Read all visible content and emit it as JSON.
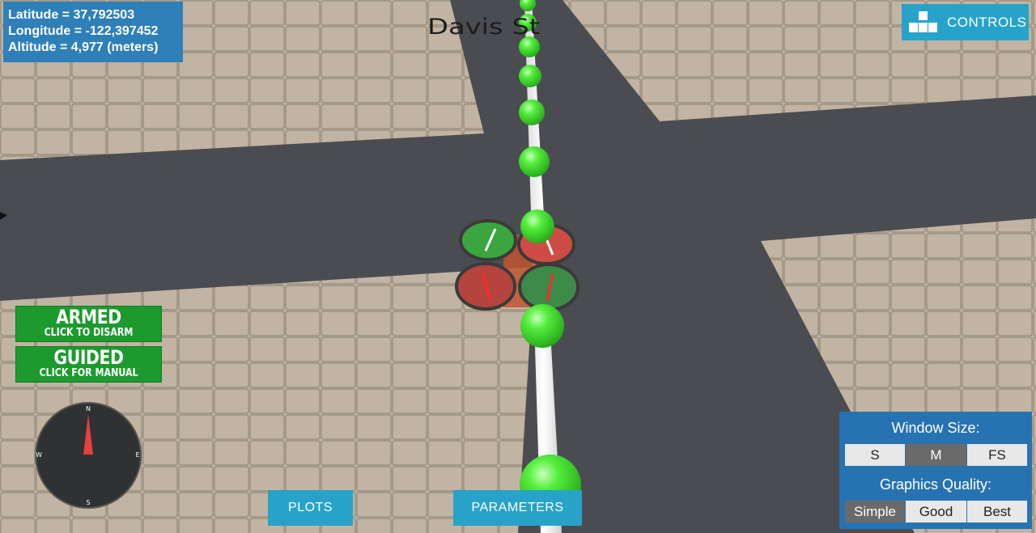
{
  "hud": {
    "latitude": "Latitude = 37,792503",
    "longitude": "Longitude = -122,397452",
    "altitude": "Altitude = 4,977 (meters)"
  },
  "scene": {
    "street_label": "Davis St"
  },
  "controls_button": {
    "label": "CONTROLS",
    "icon": "controls-icon"
  },
  "armed_button": {
    "title": "ARMED",
    "subtitle": "CLICK TO DISARM"
  },
  "guided_button": {
    "title": "GUIDED",
    "subtitle": "CLICK FOR MANUAL"
  },
  "compass": {
    "n": "N",
    "e": "E",
    "s": "S",
    "w": "W"
  },
  "bottom_buttons": {
    "plots": "PLOTS",
    "parameters": "PARAMETERS"
  },
  "settings_panel": {
    "window_size_title": "Window Size:",
    "window_sizes": [
      "S",
      "M",
      "FS"
    ],
    "window_size_selected": "M",
    "graphics_title": "Graphics Quality:",
    "graphics_options": [
      "Simple",
      "Good",
      "Best"
    ],
    "graphics_selected": "Simple"
  },
  "colors": {
    "panel_blue": "#2773b2",
    "button_cyan": "#27a3c9",
    "armed_green": "#1c9a2e",
    "waypoint_green": "#4fe83c",
    "road_gray": "#4a4c52",
    "pavement": "#b8aa98"
  }
}
